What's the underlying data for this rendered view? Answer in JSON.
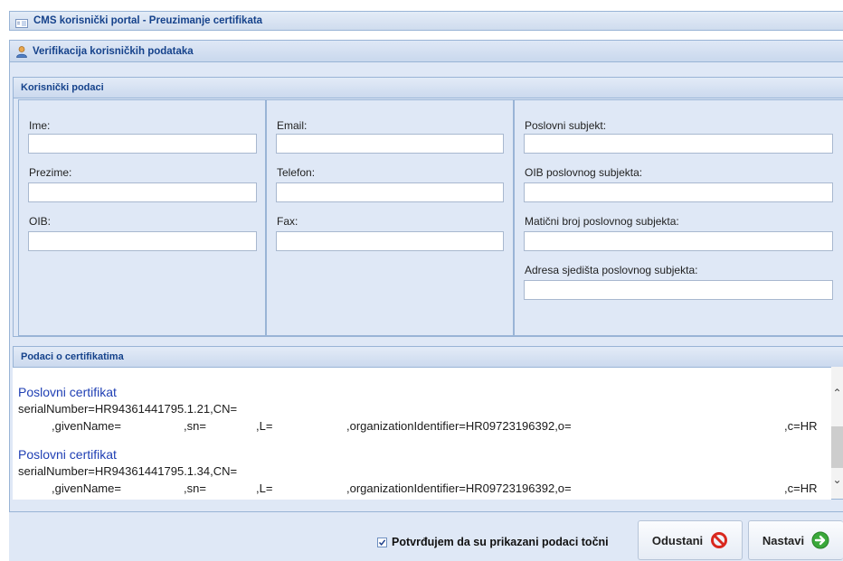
{
  "window": {
    "title": "CMS korisnički portal - Preuzimanje certifikata"
  },
  "subheader": {
    "title": "Verifikacija korisničkih podataka"
  },
  "user_section": {
    "title": "Korisnički podaci",
    "columns": [
      {
        "fields": [
          {
            "label": "Ime:",
            "value": ""
          },
          {
            "label": "Prezime:",
            "value": ""
          },
          {
            "label": "OIB:",
            "value": ""
          }
        ]
      },
      {
        "fields": [
          {
            "label": "Email:",
            "value": ""
          },
          {
            "label": "Telefon:",
            "value": ""
          },
          {
            "label": "Fax:",
            "value": ""
          }
        ]
      },
      {
        "fields": [
          {
            "label": "Poslovni subjekt:",
            "value": ""
          },
          {
            "label": "OIB poslovnog subjekta:",
            "value": ""
          },
          {
            "label": "Matični broj poslovnog subjekta:",
            "value": ""
          },
          {
            "label": "Adresa sjedišta poslovnog subjekta:",
            "value": ""
          }
        ]
      }
    ]
  },
  "cert_section": {
    "title": "Podaci o certifikatima",
    "certs": [
      {
        "title": "Poslovni certifikat",
        "line1": "serialNumber=HR94361441795.1.21,CN=",
        "given": ",givenName=",
        "sn": ",sn=",
        "l": ",L=",
        "org": ",organizationIdentifier=HR09723196392,o=",
        "c": ",c=HR"
      },
      {
        "title": "Poslovni certifikat",
        "line1": "serialNumber=HR94361441795.1.34,CN=",
        "given": ",givenName=",
        "sn": ",sn=",
        "l": ",L=",
        "org": ",organizationIdentifier=HR09723196392,o=",
        "c": ",c=HR"
      }
    ]
  },
  "footer": {
    "confirm_label": "Potvrđujem da su prikazani podaci točni",
    "confirm_checked": true,
    "cancel_label": "Odustani",
    "next_label": "Nastavi"
  },
  "colors": {
    "accent": "#15428b",
    "link": "#1f3fb4",
    "panel": "#dfe8f6",
    "cancel": "#d9281e",
    "next": "#3aa83a"
  },
  "icons": {
    "window": "window-icon",
    "user": "user-icon",
    "cancel": "no-entry-icon",
    "next": "arrow-right-icon"
  }
}
